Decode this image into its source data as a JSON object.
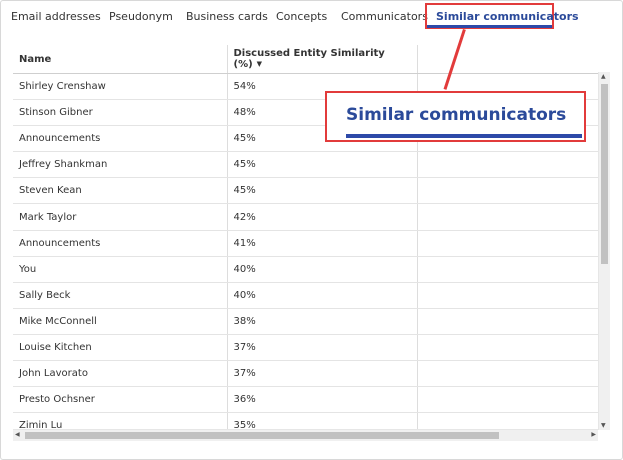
{
  "tabs": [
    {
      "label": "Email addresses"
    },
    {
      "label": "Pseudonym"
    },
    {
      "label": "Business cards"
    },
    {
      "label": "Concepts"
    },
    {
      "label": "Communicators"
    },
    {
      "label": "Similar communicators",
      "active": true
    }
  ],
  "table": {
    "columns": [
      "Name",
      "Discussed Entity Similarity (%)",
      ""
    ],
    "sorted_column_icon": "caret-down-icon",
    "rows": [
      {
        "name": "Shirley Crenshaw",
        "similarity": "54%"
      },
      {
        "name": "Stinson Gibner",
        "similarity": "48%"
      },
      {
        "name": "Announcements",
        "similarity": "45%"
      },
      {
        "name": "Jeffrey Shankman",
        "similarity": "45%"
      },
      {
        "name": "Steven Kean",
        "similarity": "45%"
      },
      {
        "name": "Mark Taylor",
        "similarity": "42%"
      },
      {
        "name": "Announcements",
        "similarity": "41%"
      },
      {
        "name": "You",
        "similarity": "40%"
      },
      {
        "name": "Sally Beck",
        "similarity": "40%"
      },
      {
        "name": "Mike McConnell",
        "similarity": "38%"
      },
      {
        "name": "Louise Kitchen",
        "similarity": "37%"
      },
      {
        "name": "John Lavorato",
        "similarity": "37%"
      },
      {
        "name": "Presto Ochsner",
        "similarity": "36%"
      },
      {
        "name": "Zimin Lu",
        "similarity": "35%"
      }
    ]
  },
  "callout": {
    "label": "Similar communicators",
    "accent": "#e23b3b",
    "text_color": "#2b4a9a"
  }
}
